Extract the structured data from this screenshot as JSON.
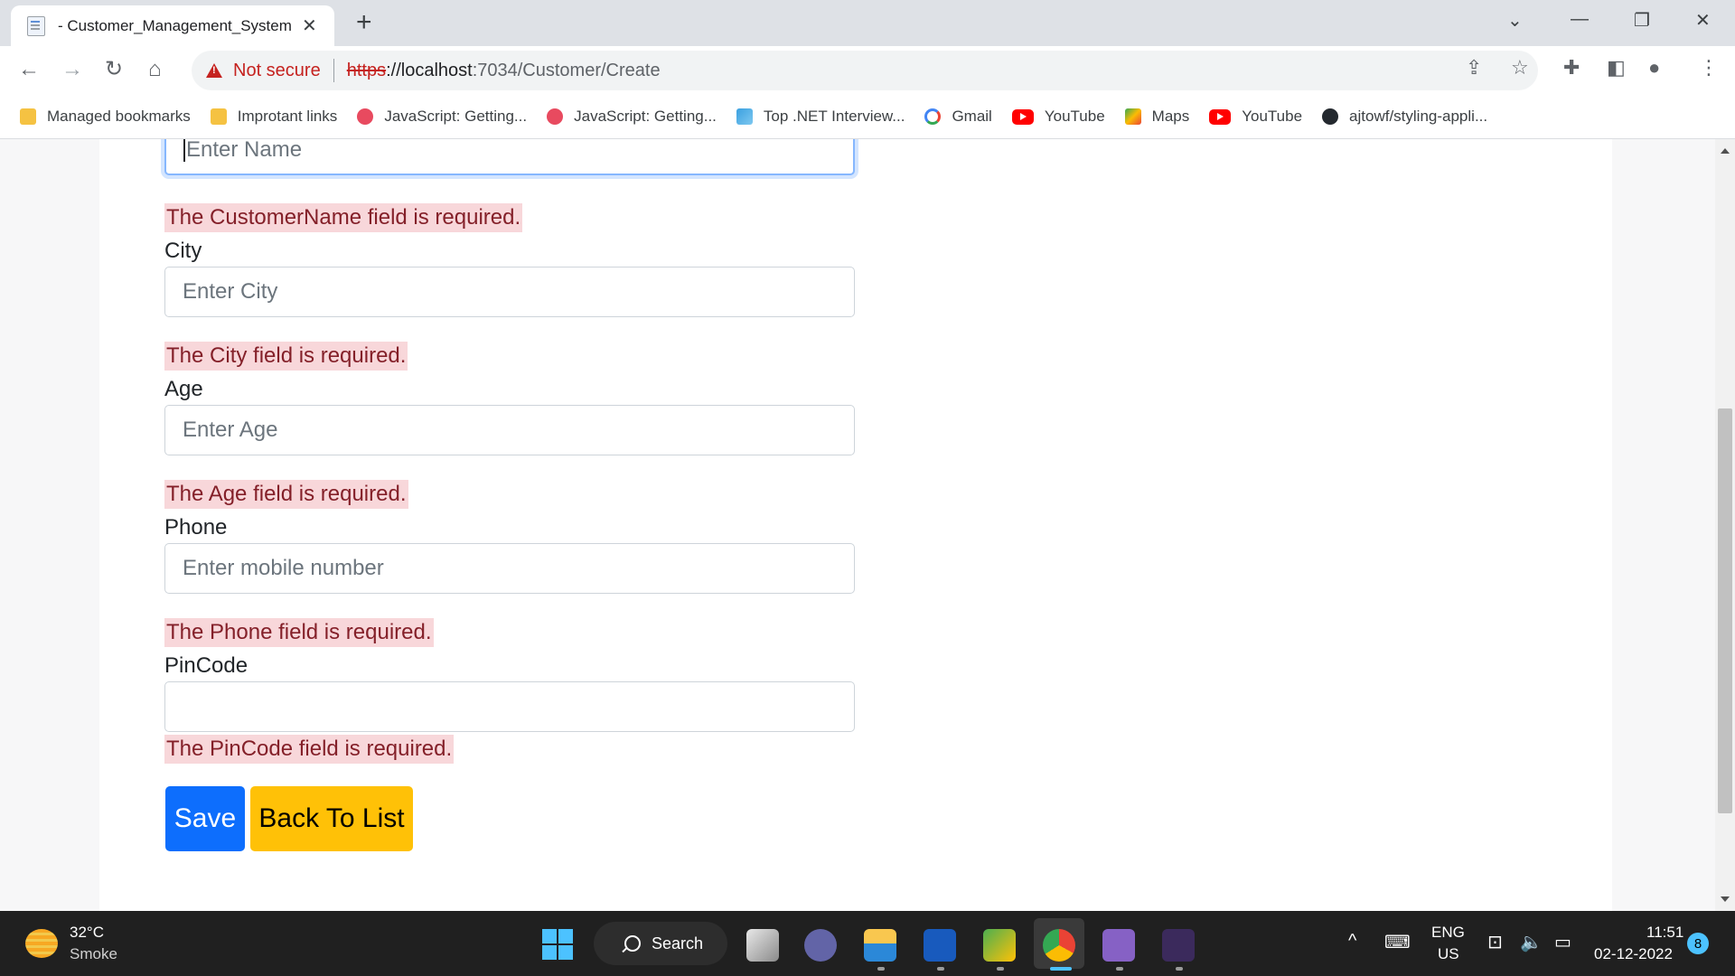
{
  "browser": {
    "tab_title": "- Customer_Management_System",
    "new_tab_label": "+",
    "omnibox": {
      "security_label": "Not secure",
      "scheme": "https",
      "host": "://localhost",
      "path": ":7034/Customer/Create"
    }
  },
  "bookmarks": [
    {
      "label": "Managed bookmarks",
      "icon": "folder-icon"
    },
    {
      "label": "Improtant links",
      "icon": "folder-icon"
    },
    {
      "label": "JavaScript: Getting...",
      "icon": "javascript-icon"
    },
    {
      "label": "JavaScript: Getting...",
      "icon": "javascript-icon"
    },
    {
      "label": "Top .NET Interview...",
      "icon": "dotnet-icon"
    },
    {
      "label": "Gmail",
      "icon": "google-icon"
    },
    {
      "label": "YouTube",
      "icon": "youtube-icon"
    },
    {
      "label": "Maps",
      "icon": "maps-icon"
    },
    {
      "label": "YouTube",
      "icon": "youtube-icon"
    },
    {
      "label": "ajtowf/styling-appli...",
      "icon": "github-icon"
    }
  ],
  "form": {
    "name_placeholder": "Enter Name",
    "name_error": "The CustomerName field is required.",
    "city_label": "City",
    "city_placeholder": "Enter City",
    "city_error": "The City field is required.",
    "age_label": "Age",
    "age_placeholder": "Enter Age",
    "age_error": "The Age field is required.",
    "phone_label": "Phone",
    "phone_placeholder": "Enter mobile number",
    "phone_error": "The Phone field is required.",
    "pincode_label": "PinCode",
    "pincode_value": "",
    "pincode_error": "The PinCode field is required.",
    "save_label": "Save",
    "back_label": "Back To List"
  },
  "taskbar": {
    "weather_temp": "32°C",
    "weather_desc": "Smoke",
    "search_label": "Search",
    "lang_top": "ENG",
    "lang_bottom": "US",
    "time": "11:51",
    "date": "02-12-2022",
    "notification_count": "8"
  },
  "colors": {
    "primary": "#0d6efd",
    "warning": "#ffc107",
    "error_text": "#842029",
    "error_bg": "#f8d7da",
    "not_secure": "#c5221f"
  }
}
